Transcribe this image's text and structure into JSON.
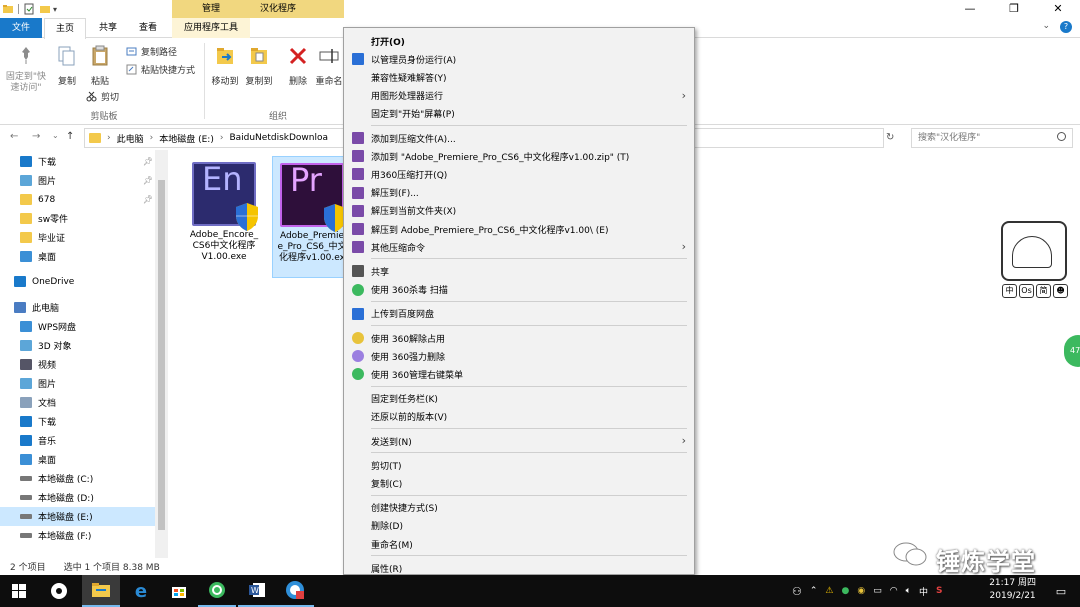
{
  "titlebar": {
    "context_tab": "管理",
    "window_title": "汉化程序"
  },
  "tabs": {
    "file": "文件",
    "home": "主页",
    "share": "共享",
    "view": "查看",
    "app_tools": "应用程序工具"
  },
  "ribbon": {
    "pin": "固定到\"快\n速访问\"",
    "copy": "复制",
    "paste": "粘贴",
    "copy_path": "复制路径",
    "paste_shortcut": "粘贴快捷方式",
    "cut": "剪切",
    "clipboard_group": "剪贴板",
    "move_to": "移动到",
    "copy_to": "复制到",
    "delete": "删除",
    "rename": "重命名",
    "organize_group": "组织"
  },
  "address": {
    "segments": [
      "此电脑",
      "本地磁盘 (E:)",
      "BaiduNetdiskDownloa"
    ],
    "search_placeholder": "搜索\"汉化程序\""
  },
  "navpane": {
    "items": [
      {
        "label": "下载",
        "icon": "download-icon",
        "pinned": true
      },
      {
        "label": "图片",
        "icon": "pictures-icon",
        "pinned": true
      },
      {
        "label": "678",
        "icon": "folder-icon",
        "pinned": true
      },
      {
        "label": "sw零件",
        "icon": "folder-icon",
        "pinned": false
      },
      {
        "label": "毕业证",
        "icon": "folder-icon",
        "pinned": false
      },
      {
        "label": "桌面",
        "icon": "desktop-icon",
        "pinned": false
      },
      {
        "label": "OneDrive",
        "icon": "onedrive-icon",
        "pinned": false
      },
      {
        "label": "此电脑",
        "icon": "computer-icon",
        "pinned": false
      },
      {
        "label": "WPS网盘",
        "icon": "wps-icon",
        "pinned": false
      },
      {
        "label": "3D 对象",
        "icon": "3d-objects-icon",
        "pinned": false
      },
      {
        "label": "视频",
        "icon": "videos-icon",
        "pinned": false
      },
      {
        "label": "图片",
        "icon": "pictures-icon",
        "pinned": false
      },
      {
        "label": "文档",
        "icon": "documents-icon",
        "pinned": false
      },
      {
        "label": "下载",
        "icon": "download-icon",
        "pinned": false
      },
      {
        "label": "音乐",
        "icon": "music-icon",
        "pinned": false
      },
      {
        "label": "桌面",
        "icon": "desktop-icon",
        "pinned": false
      },
      {
        "label": "本地磁盘 (C:)",
        "icon": "drive-icon",
        "pinned": false
      },
      {
        "label": "本地磁盘 (D:)",
        "icon": "drive-icon",
        "pinned": false
      },
      {
        "label": "本地磁盘 (E:)",
        "icon": "drive-icon",
        "pinned": false
      },
      {
        "label": "本地磁盘 (F:)",
        "icon": "drive-icon",
        "pinned": false
      }
    ]
  },
  "files": [
    {
      "name_line1": "Adobe_Encore_",
      "name_line2": "CS6中文化程序",
      "name_line3": "V1.00.exe",
      "glyph": "En",
      "selected": false
    },
    {
      "name_line1": "Adobe_Premie",
      "name_line2": "e_Pro_CS6_中文",
      "name_line3": "化程序v1.00.ex",
      "glyph": "Pr",
      "selected": true
    }
  ],
  "statusbar": {
    "count": "2 个项目",
    "selection": "选中 1 个项目  8.38 MB"
  },
  "context_menu": {
    "items": [
      {
        "label": "打开(O)",
        "bold": true
      },
      {
        "label": "以管理员身份运行(A)",
        "icon": "uac-shield-icon"
      },
      {
        "label": "兼容性疑难解答(Y)"
      },
      {
        "label": "用图形处理器运行",
        "submenu": true
      },
      {
        "label": "固定到\"开始\"屏幕(P)"
      },
      {
        "sep": true
      },
      {
        "label": "添加到压缩文件(A)...",
        "icon": "archive-icon"
      },
      {
        "label": "添加到 \"Adobe_Premiere_Pro_CS6_中文化程序v1.00.zip\" (T)",
        "icon": "archive-icon"
      },
      {
        "label": "用360压缩打开(Q)",
        "icon": "archive-icon"
      },
      {
        "label": "解压到(F)...",
        "icon": "archive-icon"
      },
      {
        "label": "解压到当前文件夹(X)",
        "icon": "archive-icon"
      },
      {
        "label": "解压到 Adobe_Premiere_Pro_CS6_中文化程序v1.00\\ (E)",
        "icon": "archive-icon"
      },
      {
        "label": "其他压缩命令",
        "icon": "archive-icon",
        "submenu": true
      },
      {
        "sep": true
      },
      {
        "label": "共享",
        "icon": "share-icon"
      },
      {
        "label": "使用 360杀毒 扫描",
        "icon": "360-antivirus-icon"
      },
      {
        "sep": true
      },
      {
        "label": "上传到百度网盘",
        "icon": "baidu-cloud-icon"
      },
      {
        "sep": true
      },
      {
        "label": "使用 360解除占用",
        "icon": "360-unlock-icon"
      },
      {
        "label": "使用 360强力删除",
        "icon": "360-delete-icon"
      },
      {
        "label": "使用 360管理右键菜单",
        "icon": "360-menu-icon"
      },
      {
        "sep": true
      },
      {
        "label": "固定到任务栏(K)"
      },
      {
        "label": "还原以前的版本(V)"
      },
      {
        "sep": true
      },
      {
        "label": "发送到(N)",
        "submenu": true
      },
      {
        "sep": true
      },
      {
        "label": "剪切(T)"
      },
      {
        "label": "复制(C)"
      },
      {
        "sep": true
      },
      {
        "label": "创建快捷方式(S)"
      },
      {
        "label": "删除(D)"
      },
      {
        "label": "重命名(M)"
      },
      {
        "sep": true
      },
      {
        "label": "属性(R)"
      }
    ]
  },
  "sticker": {
    "buttons": [
      "中",
      "Os",
      "简",
      "☻"
    ]
  },
  "green_bubble": "47",
  "watermark": "锤炼学堂",
  "taskbar": {
    "clock_time": "21:17 周四",
    "clock_date": "2019/2/21",
    "ime": "中"
  },
  "colors": {
    "accent": "#1979ca",
    "context_tab": "#f1d77f",
    "selection": "#cce8ff",
    "menu_bg": "#f2f2f2",
    "taskbar": "#0d0d0d"
  }
}
